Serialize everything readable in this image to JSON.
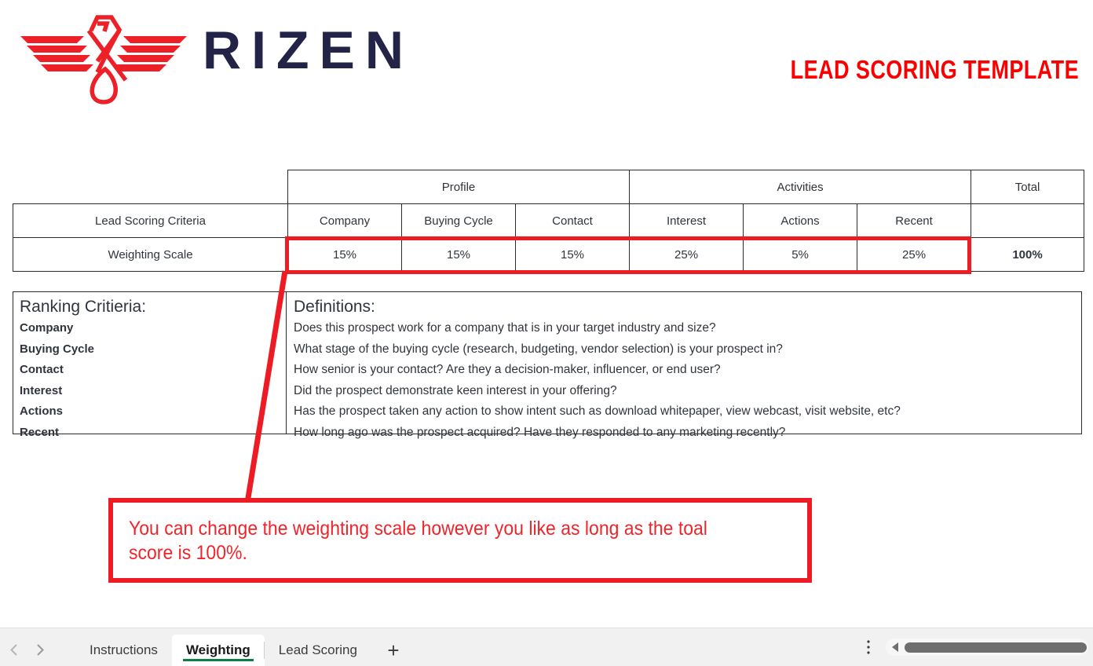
{
  "header": {
    "brand_name": "RIZEN",
    "document_title": "LEAD SCORING TEMPLATE",
    "brand_red": "#ed2027",
    "brand_navy": "#232348",
    "title_red": "#fb0000"
  },
  "table": {
    "group_headers": [
      {
        "label": "Profile",
        "span": 3
      },
      {
        "label": "Activities",
        "span": 3
      },
      {
        "label": "Total",
        "span": 1
      }
    ],
    "criteria_row_label": "Lead Scoring Criteria",
    "criteria_columns": [
      "Company",
      "Buying Cycle",
      "Contact",
      "Interest",
      "Actions",
      "Recent"
    ],
    "weighting_row_label": "Weighting Scale",
    "weighting_values": [
      "15%",
      "15%",
      "15%",
      "25%",
      "5%",
      "25%"
    ],
    "total_value": "100%",
    "header_bg": "#0d3c64",
    "highlight_bg": "#bde0cc",
    "total_bg": "#f7ae4f",
    "selection_border": "#ed1c24"
  },
  "criteria_panel": {
    "criteria_heading": "Ranking Critieria:",
    "criteria_items": [
      "Company",
      "Buying Cycle",
      "Contact",
      "Interest",
      "Actions",
      "Recent"
    ],
    "definitions_heading": "Definitions:",
    "definitions": [
      "Does this prospect work for a company that is in your target industry and size?",
      "What stage of the buying cycle (research, budgeting, vendor selection) is your prospect in?",
      "How senior is your contact?  Are they a decision-maker, influencer, or end user?",
      "Did the prospect demonstrate keen interest in your offering?",
      "Has the prospect taken any action to show intent such as download whitepaper, view webcast, visit website, etc?",
      "How long ago was the prospect acquired?  Have they responded to any marketing recently?"
    ]
  },
  "callout": {
    "text": "You can change the weighting scale however you like as long as the toal score is 100%.",
    "border_color": "#ed1c24",
    "text_color": "#f0252b"
  },
  "sheet_bar": {
    "prev_sheet_icon": "chevron-left-icon",
    "next_sheet_icon": "chevron-right-icon",
    "tabs": [
      {
        "label": "Instructions",
        "active": false
      },
      {
        "label": "Weighting",
        "active": true
      },
      {
        "label": "Lead Scoring",
        "active": false
      }
    ],
    "add_sheet_label": "+",
    "options_icon": "⋮",
    "scroll_left_icon": "◀",
    "active_tab_underline": "#107c41"
  }
}
